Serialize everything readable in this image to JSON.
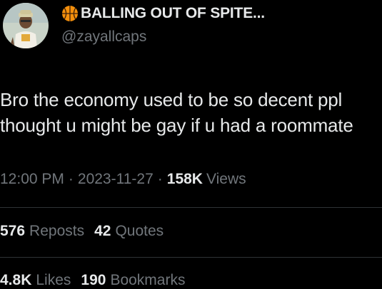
{
  "author": {
    "emoji_icon": "basketball-icon",
    "display_name": "BALLING OUT OF SPITE...",
    "handle": "@zayallcaps"
  },
  "tweet": {
    "lines": [
      "Bro the economy used to be so decent ppl",
      "thought u might be gay if u had a roommate"
    ]
  },
  "meta": {
    "time": "12:00 PM",
    "separator": "·",
    "date": "2023-11-27",
    "views_count": "158K",
    "views_label": "Views"
  },
  "stats_row_1": {
    "reposts_count": "576",
    "reposts_label": "Reposts",
    "quotes_count": "42",
    "quotes_label": "Quotes"
  },
  "stats_row_2": {
    "likes_count": "4.8K",
    "likes_label": "Likes",
    "bookmarks_count": "190",
    "bookmarks_label": "Bookmarks"
  },
  "colors": {
    "background": "#000000",
    "primary_text": "#e7e9ea",
    "secondary_text": "#71767b",
    "divider": "#2f3336",
    "basketball": "#f4900c"
  }
}
